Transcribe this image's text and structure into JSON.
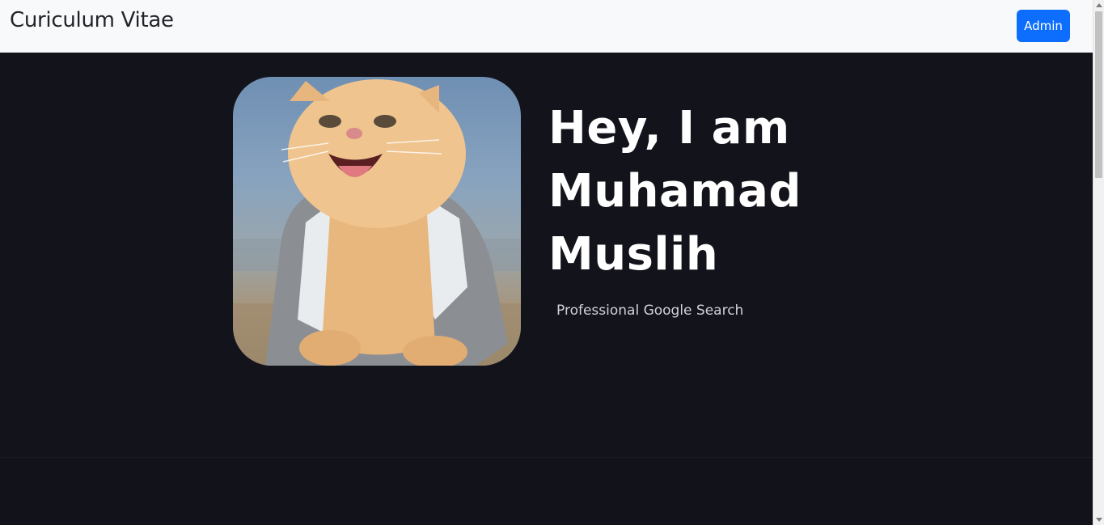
{
  "navbar": {
    "brand": "Curiculum Vitae",
    "admin_label": "Admin"
  },
  "hero": {
    "heading_lines": [
      "Hey, I am",
      "Muhamad",
      "Muslih"
    ],
    "subtitle": "Professional Google Search",
    "photo_alt": "Profile photo of a cat wearing a jacket"
  },
  "colors": {
    "navbar_bg": "#f8f9fa",
    "page_bg": "#13141b",
    "accent": "#0d6efd",
    "heading": "#ffffff",
    "subtitle": "#cfd1d6"
  },
  "icons": {
    "scroll_up": "chevron-up-icon",
    "scroll_down": "chevron-down-icon"
  }
}
